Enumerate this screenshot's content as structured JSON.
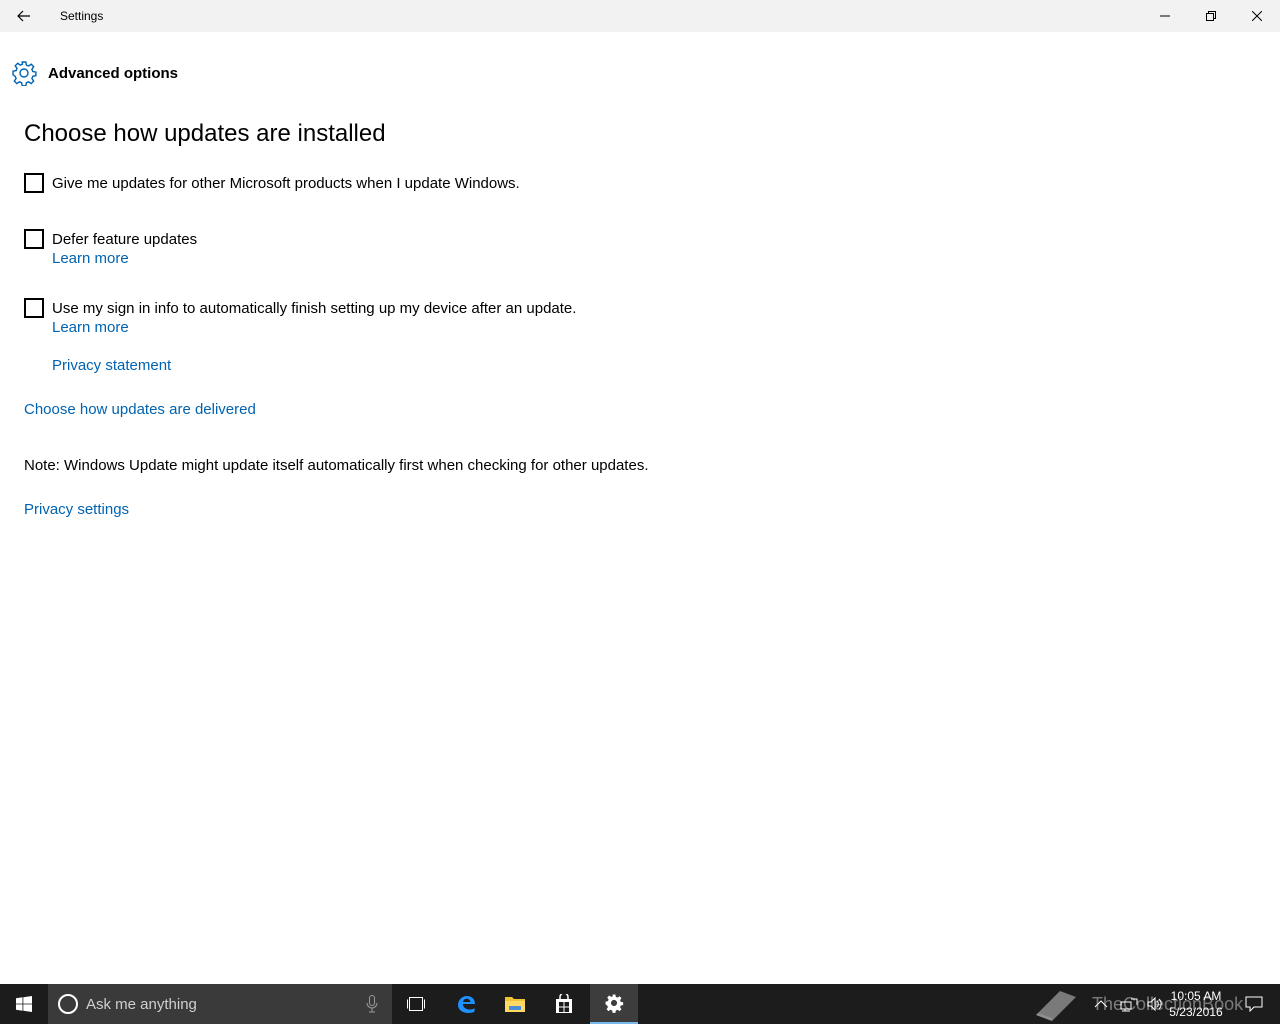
{
  "window": {
    "title": "Settings",
    "back_icon": "arrow-left",
    "controls": [
      "minimize",
      "maximize",
      "close"
    ]
  },
  "header": {
    "icon": "gear",
    "title": "Advanced options"
  },
  "section": {
    "title": "Choose how updates are installed"
  },
  "options": [
    {
      "label": "Give me updates for other Microsoft products when I update Windows.",
      "checked": false
    },
    {
      "label": "Defer feature updates",
      "checked": false,
      "link": "Learn more"
    },
    {
      "label": "Use my sign in info to automatically finish setting up my device after an update.",
      "checked": false,
      "link": "Learn more"
    }
  ],
  "links": {
    "privacy_statement": "Privacy statement",
    "delivery": "Choose how updates are delivered",
    "privacy_settings": "Privacy settings"
  },
  "note": "Note: Windows Update might update itself automatically first when checking for other updates.",
  "accent_color": "#0063b1",
  "taskbar": {
    "search_placeholder": "Ask me anything",
    "clock_time": "10:05 AM",
    "clock_date": "5/23/2016",
    "watermark": "TheCollectionBook"
  }
}
